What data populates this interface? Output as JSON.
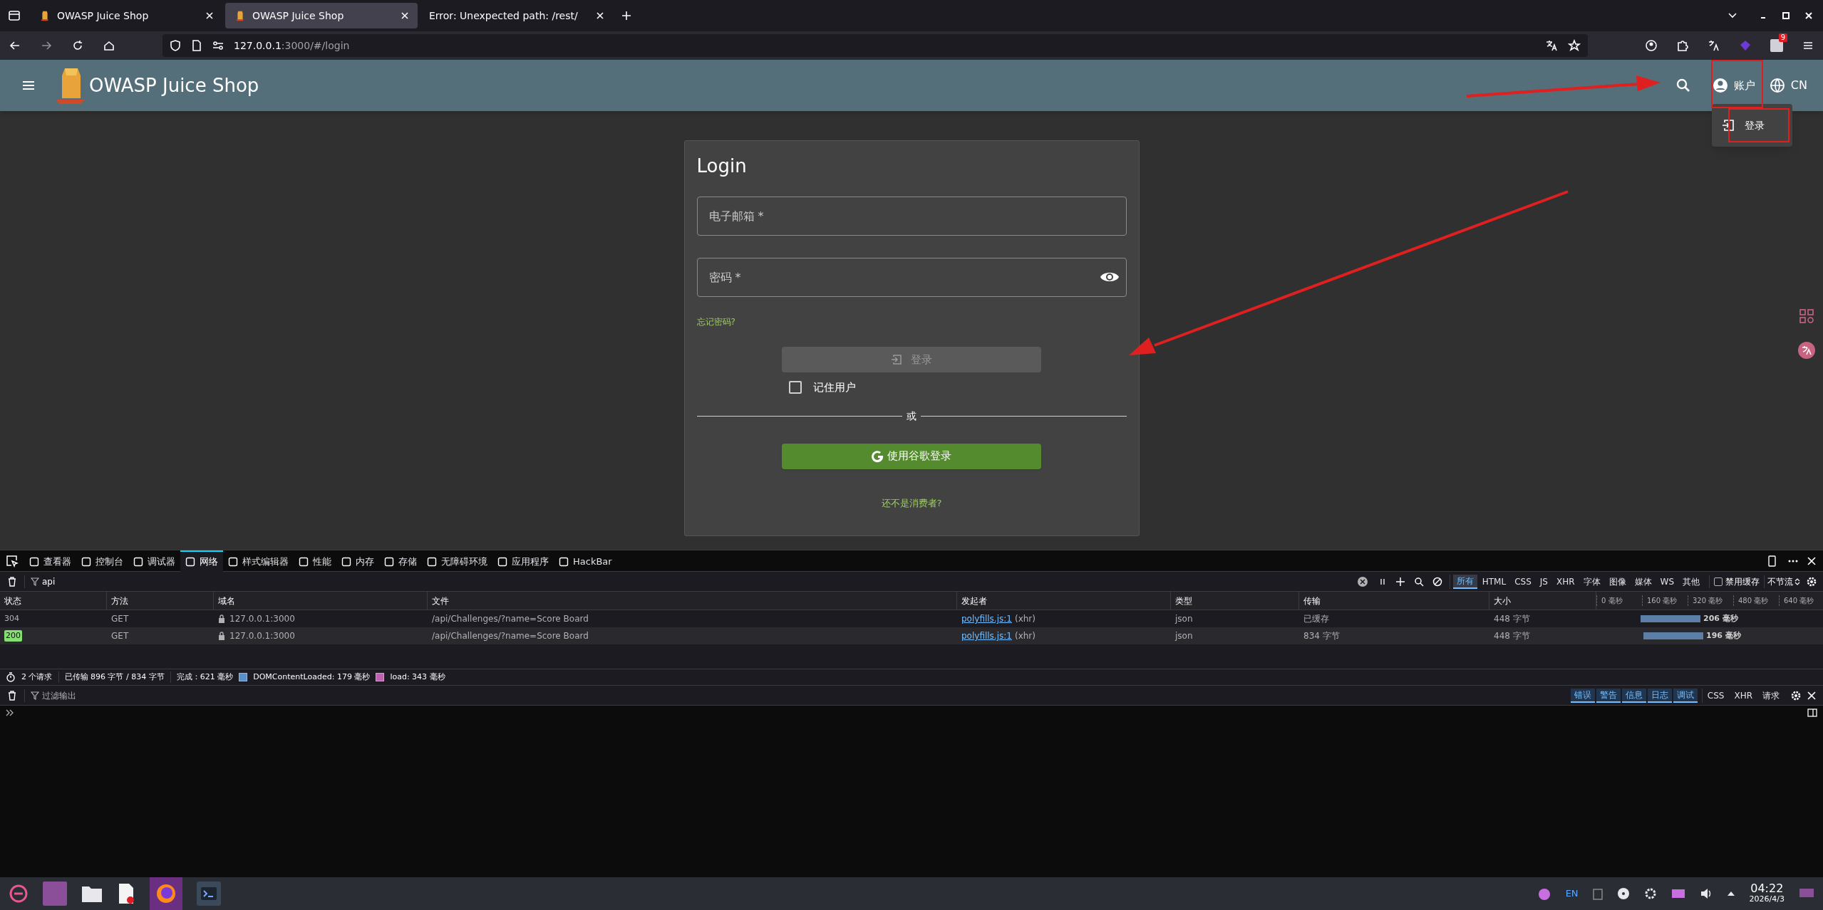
{
  "browser": {
    "tabs": [
      {
        "title": "OWASP Juice Shop",
        "selected": false
      },
      {
        "title": "OWASP Juice Shop",
        "selected": true
      },
      {
        "title": "Error: Unexpected path: /rest/",
        "selected": false
      }
    ],
    "url_host": "127.0.0.1",
    "url_rest": ":3000/#/login",
    "extension_badge": "9"
  },
  "app": {
    "title": "OWASP Juice Shop",
    "account_label": "账户",
    "language": "CN",
    "menu_items": [
      "登录"
    ]
  },
  "login": {
    "title": "Login",
    "email_placeholder": "电子邮箱 *",
    "password_placeholder": "密码 *",
    "forgot_link": "忘记密码?",
    "login_button": "登录",
    "login_disabled": true,
    "remember_label": "记住用户",
    "remember_checked": false,
    "divider": "或",
    "google_button": "使用谷歌登录",
    "signup_link": "还不是消费者?"
  },
  "devtools": {
    "tabs": [
      {
        "label": "查看器",
        "selected": false
      },
      {
        "label": "控制台",
        "selected": false
      },
      {
        "label": "调试器",
        "selected": false
      },
      {
        "label": "网络",
        "selected": true
      },
      {
        "label": "样式编辑器",
        "selected": false
      },
      {
        "label": "性能",
        "selected": false
      },
      {
        "label": "内存",
        "selected": false
      },
      {
        "label": "存储",
        "selected": false
      },
      {
        "label": "无障碍环境",
        "selected": false
      },
      {
        "label": "应用程序",
        "selected": false
      },
      {
        "label": "HackBar",
        "selected": false
      }
    ],
    "filter": "api",
    "type_filters": [
      {
        "label": "所有",
        "selected": true
      },
      {
        "label": "HTML",
        "selected": false
      },
      {
        "label": "CSS",
        "selected": false
      },
      {
        "label": "JS",
        "selected": false
      },
      {
        "label": "XHR",
        "selected": false
      },
      {
        "label": "字体",
        "selected": false
      },
      {
        "label": "图像",
        "selected": false
      },
      {
        "label": "媒体",
        "selected": false
      },
      {
        "label": "WS",
        "selected": false
      },
      {
        "label": "其他",
        "selected": false
      }
    ],
    "disable_cache": {
      "label": "禁用缓存",
      "checked": false
    },
    "throttle": "不节流",
    "columns": [
      "状态",
      "方法",
      "域名",
      "文件",
      "发起者",
      "类型",
      "传输",
      "大小"
    ],
    "timeline_ticks": [
      "0 毫秒",
      "160 毫秒",
      "320 毫秒",
      "480 毫秒",
      "640 毫秒"
    ],
    "rows": [
      {
        "status": "304",
        "highlighted": false,
        "method": "GET",
        "domain": "127.0.0.1:3000",
        "file": "/api/Challenges/?name=Score Board",
        "initiator": "polyfills.js:1",
        "initiator_note": "(xhr)",
        "type": "json",
        "transfer": "已缓存",
        "size": "448 字节",
        "duration": "206 毫秒"
      },
      {
        "status": "200",
        "highlighted": true,
        "method": "GET",
        "domain": "127.0.0.1:3000",
        "file": "/api/Challenges/?name=Score Board",
        "initiator": "polyfills.js:1",
        "initiator_note": "(xhr)",
        "type": "json",
        "transfer": "834 字节",
        "size": "448 字节",
        "duration": "196 毫秒"
      }
    ],
    "summary": {
      "requests": "2 个请求",
      "transferred": "已传输 896 字节 / 834 字节",
      "finish": "完成：621 毫秒",
      "dom_loaded": "DOMContentLoaded: 179 毫秒",
      "load": "load: 343 毫秒"
    },
    "console": {
      "filter_placeholder": "过滤输出",
      "levels": [
        {
          "label": "错误",
          "on": true
        },
        {
          "label": "警告",
          "on": true
        },
        {
          "label": "信息",
          "on": true
        },
        {
          "label": "日志",
          "on": true
        },
        {
          "label": "调试",
          "on": true
        }
      ],
      "extras": [
        "CSS",
        "XHR",
        "请求"
      ]
    }
  },
  "taskbar": {
    "language": "EN",
    "time": "04:22",
    "date": "2026/4/3"
  }
}
